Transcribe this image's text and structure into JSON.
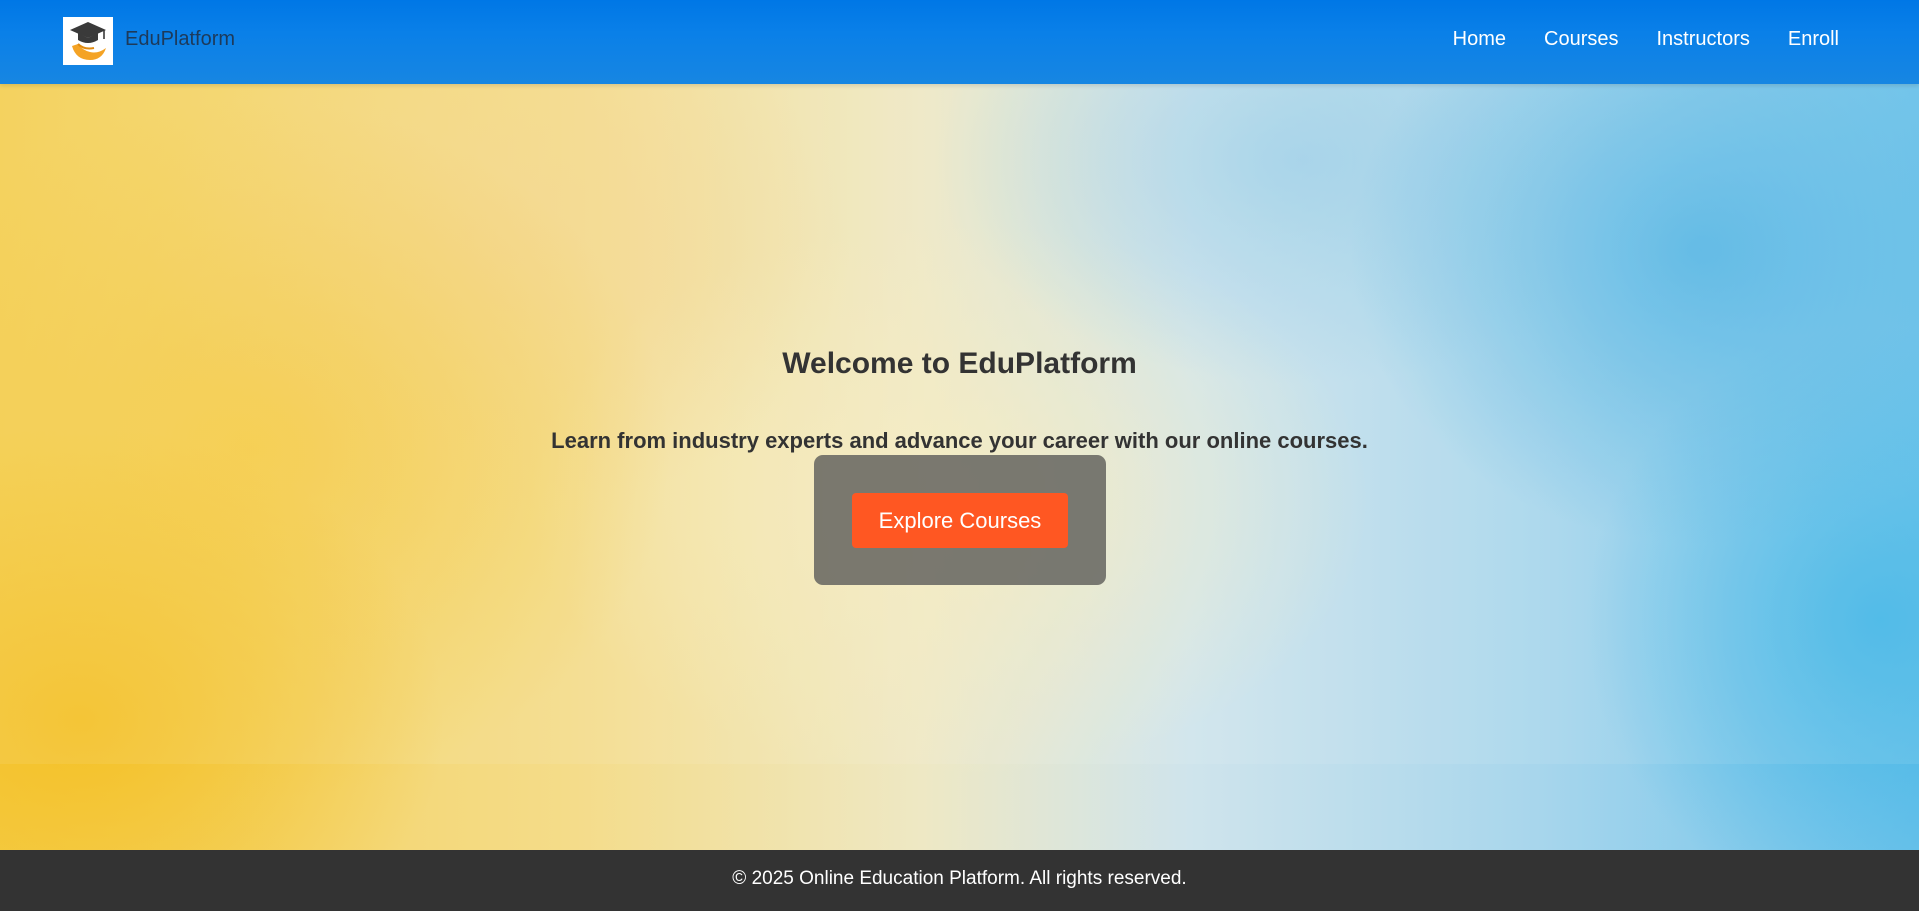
{
  "header": {
    "brand": "EduPlatform",
    "logo_icon": "graduation-cap-hand-icon",
    "nav": [
      {
        "label": "Home"
      },
      {
        "label": "Courses"
      },
      {
        "label": "Instructors"
      },
      {
        "label": "Enroll"
      }
    ],
    "colors": {
      "bar": "#0077e6",
      "nav_text": "#ffffff"
    }
  },
  "hero": {
    "title": "Welcome to EduPlatform",
    "subtitle": "Learn from industry experts and advance your career with our online courses.",
    "cta_label": "Explore Courses",
    "colors": {
      "cta": "#ff5722",
      "panel": "#64645f"
    }
  },
  "footer": {
    "text": "© 2025 Online Education Platform. All rights reserved.",
    "colors": {
      "background": "#333333"
    }
  }
}
